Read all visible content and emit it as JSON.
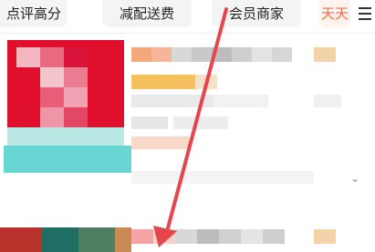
{
  "filters": {
    "chip1": "点评高分",
    "chip2": "减配送费",
    "chip3": "会员商家",
    "promo": "天天"
  },
  "icons": {
    "menu": "menu-icon",
    "chevron": "chevron-down-icon"
  },
  "colors": {
    "promo": "#ff6a3d",
    "image_red": "#e0102c",
    "image_teal": "#68d7d3",
    "arrow": "#e4464b"
  }
}
